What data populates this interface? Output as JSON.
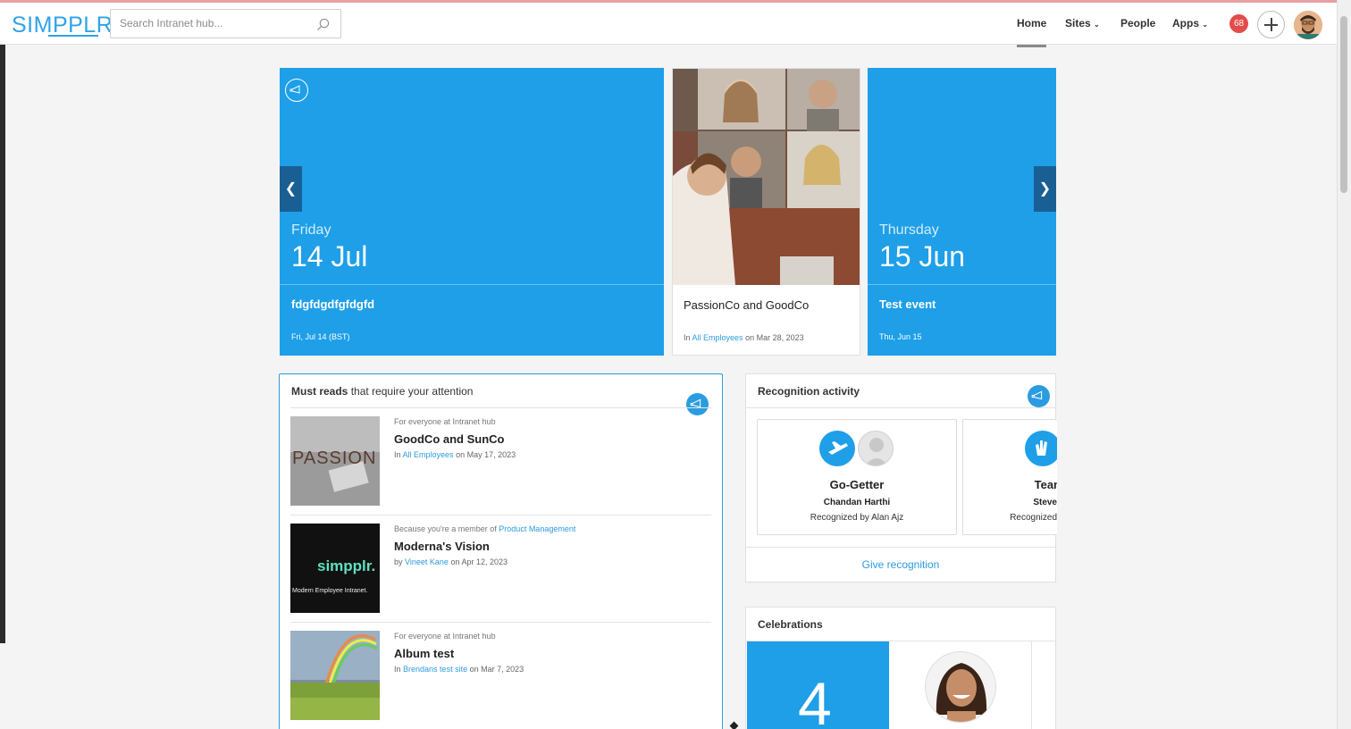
{
  "header": {
    "logo": "SIMPPLR",
    "search_placeholder": "Search Intranet hub...",
    "nav": {
      "home": "Home",
      "sites": "Sites",
      "people": "People",
      "apps": "Apps"
    },
    "notification_count": "68"
  },
  "carousel": [
    {
      "day": "Friday",
      "date": "14 Jul",
      "title": "fdgfdgdfgfdgfd",
      "meta": "Fri, Jul 14 (BST)"
    },
    {
      "title": "PassionCo and GoodCo",
      "meta_prefix": "In",
      "meta_link": "All Employees",
      "meta_suffix": "on Mar 28, 2023"
    },
    {
      "day": "Thursday",
      "date": "15 Jun",
      "title": "Test event",
      "meta": "Thu, Jun 15"
    }
  ],
  "must_reads": {
    "title_bold": "Must reads",
    "title_rest": "that require your attention",
    "items": [
      {
        "context": "For everyone at Intranet hub",
        "context_link": "",
        "title": "GoodCo and SunCo",
        "meta_prefix": "In",
        "meta_link": "All Employees",
        "meta_suffix": "on May 17, 2023",
        "thumb_text": "PASSION"
      },
      {
        "context": "Because you're a member of",
        "context_link": "Product Management",
        "title": "Moderna's Vision",
        "meta_prefix": "by",
        "meta_link": "Vineet Kane",
        "meta_suffix": "on Apr 12, 2023",
        "thumb_text": "simpplr.",
        "thumb_subtext": "Modern Employee Intranet."
      },
      {
        "context": "For everyone at Intranet hub",
        "context_link": "",
        "title": "Album test",
        "meta_prefix": "In",
        "meta_link": "Brendans test site",
        "meta_suffix": "on Mar 7, 2023"
      }
    ]
  },
  "recognition": {
    "title": "Recognition activity",
    "cards": [
      {
        "award": "Go-Getter",
        "name": "Chandan Harthi",
        "by": "Recognized by Alan Ajz"
      },
      {
        "award": "Tean",
        "name": "Steve",
        "by": "Recognized"
      }
    ],
    "give_label": "Give recognition"
  },
  "celebrations": {
    "title": "Celebrations",
    "count": "4"
  },
  "colors": {
    "accent": "#1e9fe8",
    "link": "#2c9ce0",
    "badge": "#e24c4b",
    "dark_arrow": "#1a5f93"
  }
}
